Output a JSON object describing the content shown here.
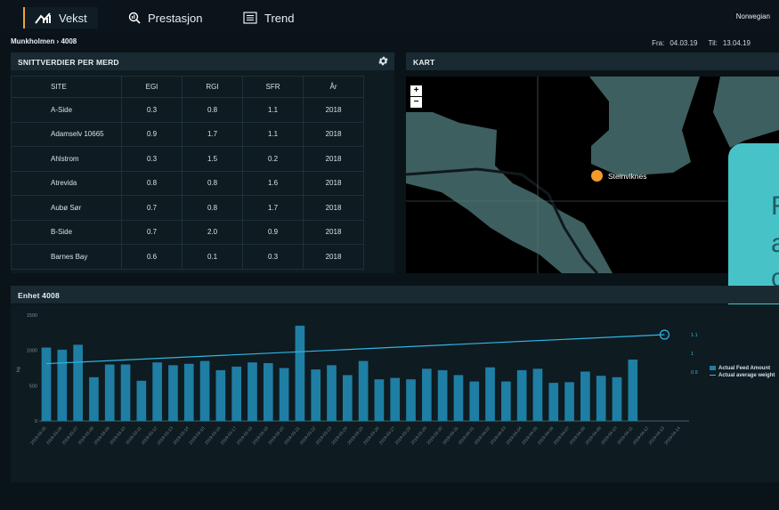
{
  "nav": {
    "tabs": [
      {
        "label": "Vekst",
        "icon": "growth-chart-icon"
      },
      {
        "label": "Prestasjon",
        "icon": "magnifier-chart-icon"
      },
      {
        "label": "Trend",
        "icon": "list-icon"
      }
    ],
    "language": "Norwegian"
  },
  "breadcrumb": "Munkholmen › 4008",
  "date_range": {
    "from_label": "Fra:",
    "from": "04.03.19",
    "to_label": "Til:",
    "to": "13.04.19"
  },
  "table_panel": {
    "title": "SNITTVERDIER PER MERD",
    "columns": [
      "SITE",
      "EGI",
      "RGI",
      "SFR",
      "År"
    ],
    "rows": [
      [
        "A-Side",
        "0.3",
        "0.8",
        "1.1",
        "2018"
      ],
      [
        "Adamselv 10665",
        "0.9",
        "1.7",
        "1.1",
        "2018"
      ],
      [
        "Ahlstrom",
        "0.3",
        "1.5",
        "0.2",
        "2018"
      ],
      [
        "Atrevida",
        "0.8",
        "0.8",
        "1.6",
        "2018"
      ],
      [
        "Aubø Sør",
        "0.7",
        "0.8",
        "1.7",
        "2018"
      ],
      [
        "B-Side",
        "0.7",
        "2.0",
        "0.9",
        "2018"
      ],
      [
        "Barnes Bay",
        "0.6",
        "0.1",
        "0.3",
        "2018"
      ]
    ]
  },
  "map_panel": {
    "title": "KART",
    "zoom_in": "+",
    "zoom_out": "−",
    "marker_label": "Steinviknes",
    "colors": {
      "water": "#3e5f5f",
      "land": "#000000",
      "marker": "#f19a2d"
    }
  },
  "overlay": {
    "line1": "R",
    "line2": "a",
    "line3": "c",
    "color": "#47c3c8"
  },
  "chart_panel": {
    "title": "Enhet 4008"
  },
  "chart_data": {
    "type": "bar",
    "title": "",
    "ylabel": "kg",
    "ylim": [
      0,
      1500
    ],
    "y_ticks": [
      0,
      500,
      1000,
      1500
    ],
    "y2_ticks": [
      "0.9",
      "1",
      "1.1"
    ],
    "categories": [
      "2019-03-05",
      "2019-03-06",
      "2019-03-07",
      "2019-03-08",
      "2019-03-09",
      "2019-03-10",
      "2019-03-11",
      "2019-03-12",
      "2019-03-13",
      "2019-03-14",
      "2019-03-15",
      "2019-03-16",
      "2019-03-17",
      "2019-03-18",
      "2019-03-19",
      "2019-03-20",
      "2019-03-21",
      "2019-03-22",
      "2019-03-23",
      "2019-03-24",
      "2019-03-25",
      "2019-03-26",
      "2019-03-27",
      "2019-03-28",
      "2019-03-29",
      "2019-03-30",
      "2019-03-31",
      "2019-04-01",
      "2019-04-02",
      "2019-04-03",
      "2019-04-04",
      "2019-04-05",
      "2019-04-06",
      "2019-04-07",
      "2019-04-08",
      "2019-04-09",
      "2019-04-10",
      "2019-04-11",
      "2019-04-12",
      "2019-04-13",
      "2019-04-14"
    ],
    "series": [
      {
        "name": "Actual Feed Amount",
        "values": [
          1040,
          1010,
          1080,
          620,
          800,
          800,
          570,
          830,
          790,
          810,
          850,
          720,
          770,
          830,
          820,
          750,
          1350,
          730,
          790,
          650,
          850,
          590,
          610,
          590,
          740,
          720,
          650,
          560,
          760,
          560,
          720,
          740,
          540,
          550,
          700,
          640,
          620,
          870,
          null,
          null,
          null
        ]
      },
      {
        "name": "Actual average weight",
        "y2_start": 0.945,
        "y2_end": 1.1
      }
    ],
    "legend_position": "right",
    "colors": {
      "bar": "#1f7ea3",
      "line": "#2fb7e3"
    }
  }
}
